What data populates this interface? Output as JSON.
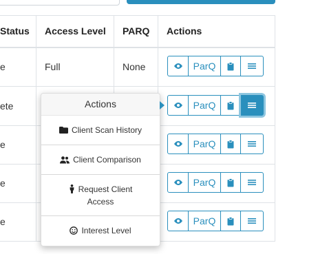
{
  "table": {
    "headers": {
      "status": "Status",
      "access_level": "Access Level",
      "parq": "PARQ",
      "actions": "Actions"
    },
    "rows": [
      {
        "status": "e",
        "access_level": "Full",
        "parq": "None"
      },
      {
        "status": "ete",
        "access_level": "",
        "parq": ""
      },
      {
        "status": "e",
        "access_level": "",
        "parq": ""
      },
      {
        "status": "e",
        "access_level": "",
        "parq": ""
      },
      {
        "status": "e",
        "access_level": "",
        "parq": ""
      }
    ],
    "action_buttons": {
      "view_icon": "eye-icon",
      "parq_label": "ParQ",
      "clipboard_icon": "clipboard-icon",
      "menu_icon": "hamburger-icon"
    }
  },
  "actions_popover": {
    "title": "Actions",
    "items": [
      {
        "label": "Client Scan History",
        "icon": "folder-icon"
      },
      {
        "label": "Client Comparison",
        "icon": "users-icon"
      },
      {
        "label_line1": "Request Client",
        "label_line2": "Access",
        "icon": "person-icon"
      },
      {
        "label": "Interest Level",
        "icon": "smiley-icon"
      }
    ]
  },
  "colors": {
    "accent": "#2a8fbd",
    "border": "#dee2e6"
  }
}
